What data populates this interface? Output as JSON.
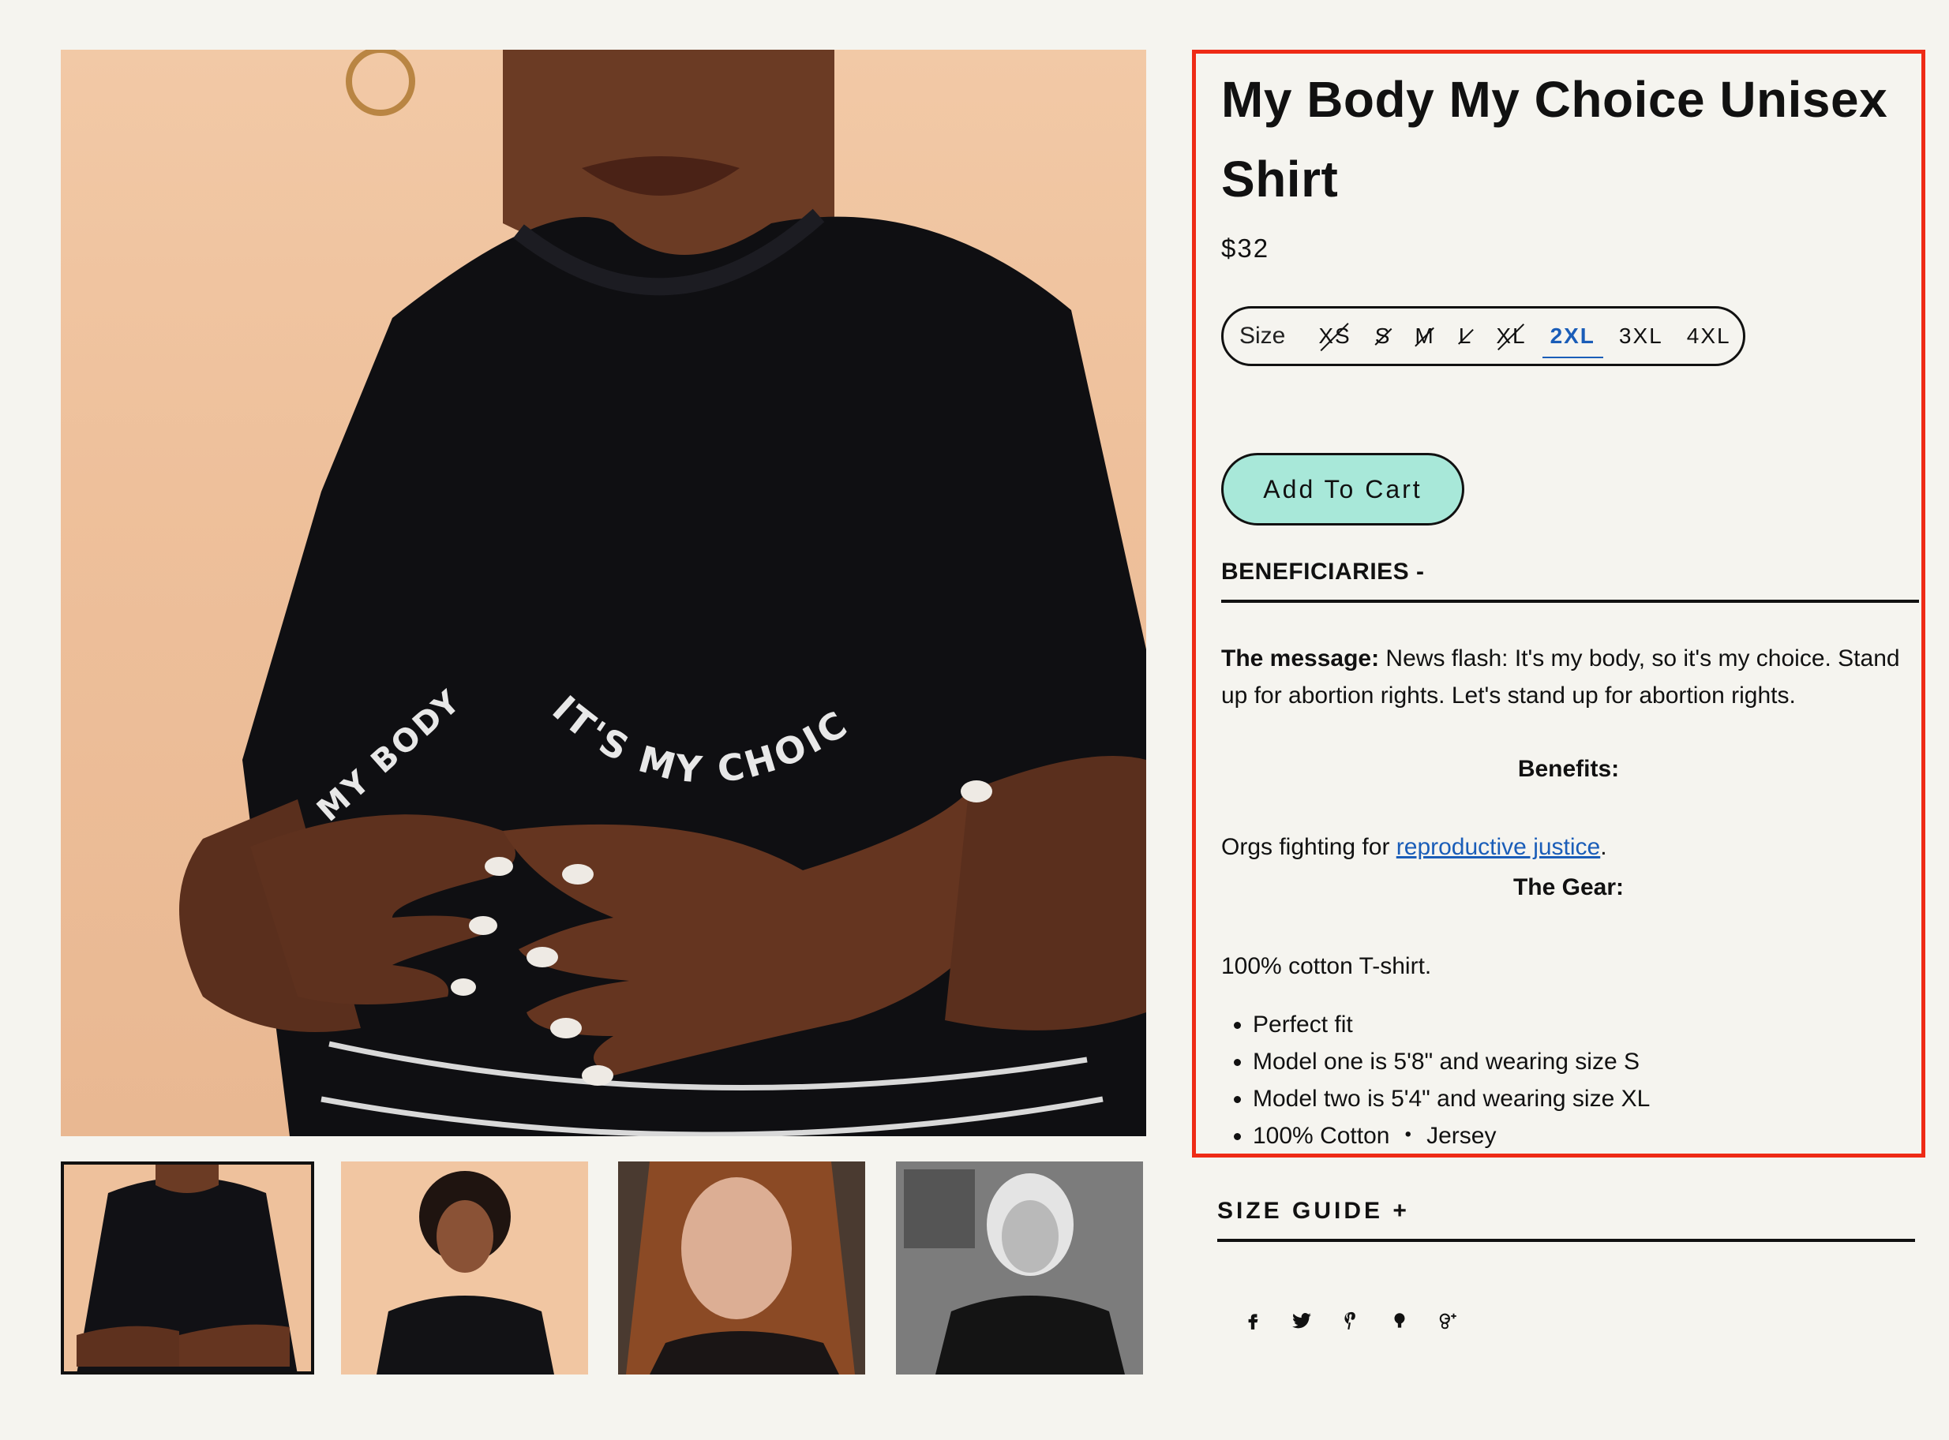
{
  "product": {
    "title": "My Body My Choice Unisex Shirt",
    "price": "$32"
  },
  "size_selector": {
    "label": "Size",
    "options": [
      {
        "label": "XS",
        "available": false
      },
      {
        "label": "S",
        "available": false
      },
      {
        "label": "M",
        "available": false
      },
      {
        "label": "L",
        "available": false
      },
      {
        "label": "XL",
        "available": false
      },
      {
        "label": "2XL",
        "available": true,
        "selected": true
      },
      {
        "label": "3XL",
        "available": true
      },
      {
        "label": "4XL",
        "available": true
      }
    ],
    "selected_color": "#1a5db8"
  },
  "cart": {
    "add_label": "Add To Cart",
    "button_color": "#a8e8d9"
  },
  "beneficiaries": {
    "heading": "BENEFICIARIES -",
    "message_label": "The message:",
    "message_text": " News flash: It's my body, so it's my choice. Stand up for abortion rights. Let's stand up for abortion rights.",
    "benefits_heading": "Benefits:",
    "benefits_prefix": "Orgs fighting for ",
    "benefits_link": "reproductive justice",
    "benefits_suffix": ".",
    "gear_heading": "The Gear:",
    "gear_text": "100% cotton T-shirt.",
    "gear_items": [
      "Perfect fit",
      "Model one is 5'8\" and wearing size S",
      "Model two is 5'4\" and wearing size XL",
      "100% Cotton ・ Jersey"
    ]
  },
  "size_guide": {
    "label": "SIZE GUIDE +"
  },
  "shirt_print": {
    "left": "MY BODY",
    "right": "IT'S MY CHOICE"
  },
  "share": {
    "icons": [
      "facebook-icon",
      "twitter-icon",
      "pinterest-icon",
      "fancy-icon",
      "google-plus-icon"
    ]
  },
  "highlight_color": "#ee2b16"
}
